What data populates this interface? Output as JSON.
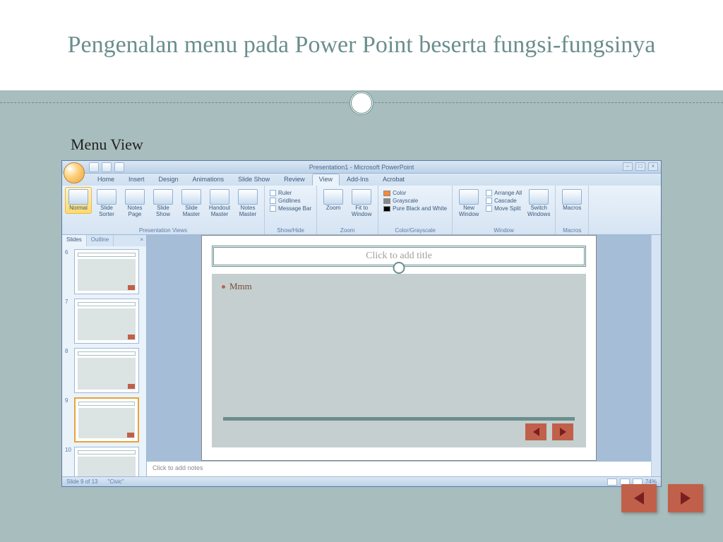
{
  "title": "Pengenalan menu pada Power Point beserta fungsi-fungsinya",
  "section_label": "Menu View",
  "window_title": "Presentation1 - Microsoft PowerPoint",
  "tabs": [
    "Home",
    "Insert",
    "Design",
    "Animations",
    "Slide Show",
    "Review",
    "View",
    "Add-Ins",
    "Acrobat"
  ],
  "active_tab_index": 6,
  "ribbon": {
    "presentation_views": {
      "label": "Presentation Views",
      "buttons": [
        "Normal",
        "Slide Sorter",
        "Notes Page",
        "Slide Show",
        "Slide Master",
        "Handout Master",
        "Notes Master"
      ]
    },
    "show_hide": {
      "label": "Show/Hide",
      "items": [
        "Ruler",
        "Gridlines",
        "Message Bar"
      ]
    },
    "zoom": {
      "label": "Zoom",
      "buttons": [
        "Zoom",
        "Fit to Window"
      ]
    },
    "color_grayscale": {
      "label": "Color/Grayscale",
      "items": [
        "Color",
        "Grayscale",
        "Pure Black and White"
      ]
    },
    "window_group": {
      "label": "Window",
      "new_window": "New Window",
      "switch": "Switch Windows",
      "items": [
        "Arrange All",
        "Cascade",
        "Move Split"
      ]
    },
    "macros": {
      "label": "Macros",
      "button": "Macros"
    }
  },
  "panel_tabs": {
    "slides": "Slides",
    "outline": "Outline"
  },
  "thumbs": [
    {
      "num": "6"
    },
    {
      "num": "7"
    },
    {
      "num": "8"
    },
    {
      "num": "9"
    },
    {
      "num": "10"
    }
  ],
  "selected_thumb_index": 3,
  "slide": {
    "title_placeholder": "Click to add title",
    "bullet_text": "Mmm"
  },
  "notes_placeholder": "Click to add notes",
  "status": {
    "slide_info": "Slide 9 of 13",
    "theme": "\"Civic\"",
    "zoom": "74%"
  }
}
